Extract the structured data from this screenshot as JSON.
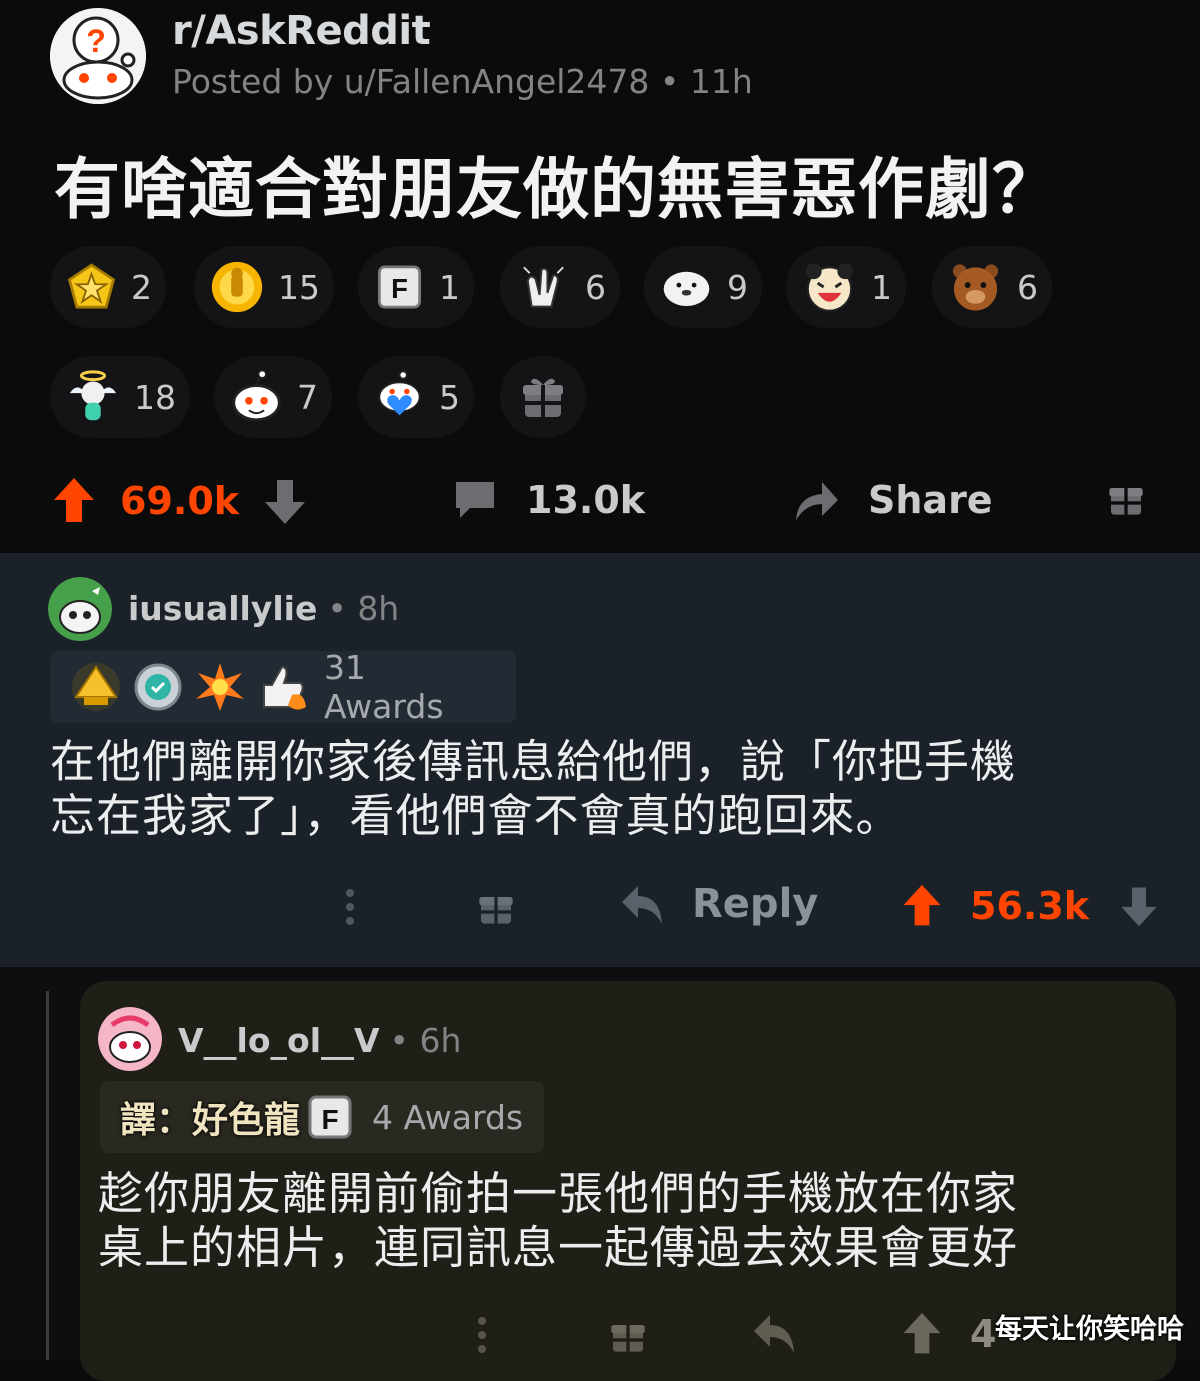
{
  "post": {
    "subreddit": "r/AskReddit",
    "posted_by": "Posted by u/FallenAngel2478 • 11h",
    "title": "有啥適合對朋友做的無害惡作劇？",
    "awards": [
      {
        "icon": "star-award-icon",
        "count": "2"
      },
      {
        "icon": "gold-trophy-award-icon",
        "count": "15"
      },
      {
        "icon": "press-f-award-icon",
        "count": "1"
      },
      {
        "icon": "clapping-hands-award-icon",
        "count": "6"
      },
      {
        "icon": "seal-award-icon",
        "count": "9"
      },
      {
        "icon": "laughing-face-award-icon",
        "count": "1"
      },
      {
        "icon": "bear-award-icon",
        "count": "6"
      },
      {
        "icon": "angel-award-icon",
        "count": "18"
      },
      {
        "icon": "snoo-award-icon",
        "count": "7"
      },
      {
        "icon": "heart-snoo-award-icon",
        "count": "5"
      }
    ],
    "upvotes": "69.0k",
    "comments": "13.0k",
    "share_label": "Share"
  },
  "comment1": {
    "username": "iusuallylie",
    "time": "• 8h",
    "awards_label": "31 Awards",
    "award_icons": [
      "gold-pyramid-award-icon",
      "silver-badge-award-icon",
      "burst-award-icon",
      "thumbs-up-award-icon"
    ],
    "body_line1": "在他們離開你家後傳訊息給他們，說「你把手機",
    "body_line2": "忘在我家了」，看他們會不會真的跑回來。",
    "reply_label": "Reply",
    "upvotes": "56.3k"
  },
  "comment2": {
    "username": "V__lo_ol__V",
    "time": "• 6h",
    "translator_note": "譯：好色龍",
    "awards_label": "4 Awards",
    "body_line1": "趁你朋友離開前偷拍一張他們的手機放在你家",
    "body_line2": "桌上的相片，連同訊息一起傳過去效果會更好",
    "upvotes_partial": "4"
  },
  "watermark": "每天让你笑哈哈",
  "colors": {
    "upvote_orange": "#ff4500",
    "post_bg": "#0b0b0c",
    "comment1_bg": "#1a2129",
    "comment2_bg": "#1f1e17"
  }
}
